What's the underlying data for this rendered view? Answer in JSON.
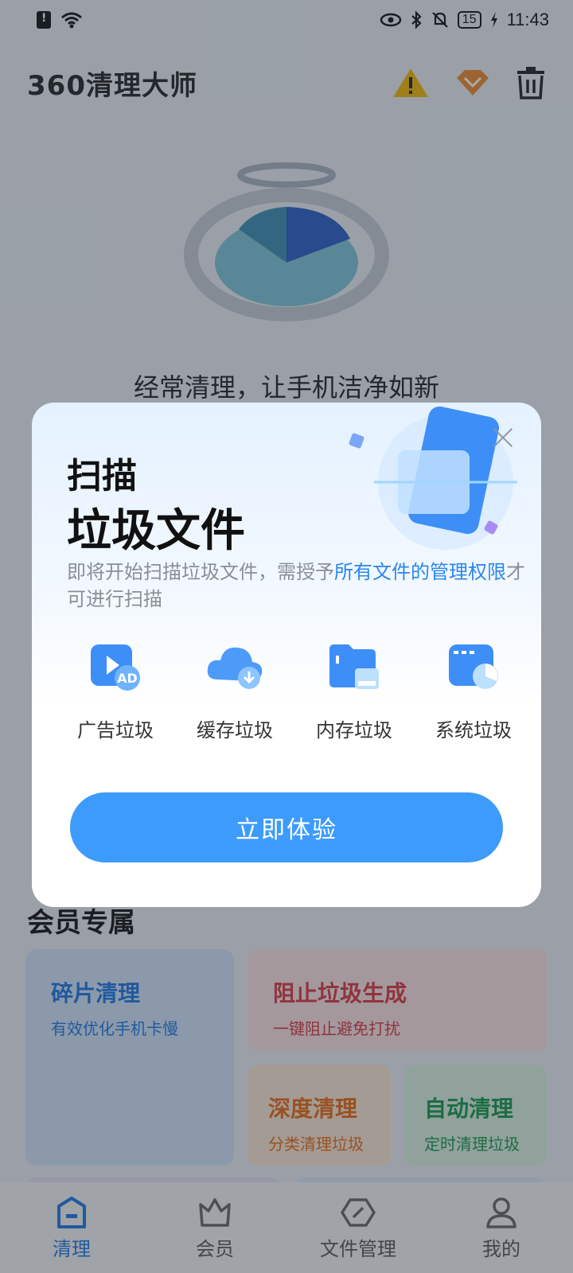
{
  "status": {
    "time": "11:43",
    "battery": "15"
  },
  "header": {
    "logo": "360清理大师"
  },
  "hero": {
    "tagline": "经常清理，让手机洁净如新"
  },
  "members": {
    "title": "会员专属",
    "cards": [
      {
        "title": "碎片清理",
        "subtitle": "有效优化手机卡慢"
      },
      {
        "title": "阻止垃圾生成",
        "subtitle": "一键阻止避免打扰"
      },
      {
        "title": "深度清理",
        "subtitle": "分类清理垃圾"
      },
      {
        "title": "自动清理",
        "subtitle": "定时清理垃圾"
      }
    ]
  },
  "nav": {
    "items": [
      {
        "label": "清理",
        "icon": "clean-icon"
      },
      {
        "label": "会员",
        "icon": "crown-icon"
      },
      {
        "label": "文件管理",
        "icon": "file-manage-icon"
      },
      {
        "label": "我的",
        "icon": "profile-icon"
      }
    ]
  },
  "dialog": {
    "title_line1": "扫描",
    "title_line2": "垃圾文件",
    "desc_prefix": "即将开始扫描垃圾文件，需授予",
    "desc_link": "所有文件的管理权限",
    "desc_suffix": "才可进行扫描",
    "categories": [
      {
        "label": "广告垃圾",
        "icon": "ad-junk-icon"
      },
      {
        "label": "缓存垃圾",
        "icon": "cache-junk-icon"
      },
      {
        "label": "内存垃圾",
        "icon": "memory-junk-icon"
      },
      {
        "label": "系统垃圾",
        "icon": "system-junk-icon"
      }
    ],
    "cta": "立即体验"
  },
  "colors": {
    "accent": "#3d9bfb",
    "link": "#2a86f0",
    "warning": "#f5b800",
    "vip": "#f08a2a"
  }
}
